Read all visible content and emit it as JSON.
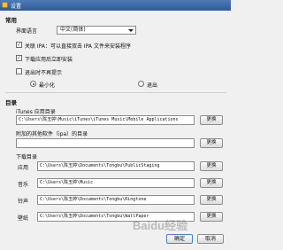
{
  "window": {
    "title": "设置"
  },
  "general": {
    "heading": "常用",
    "language_label": "界面语言",
    "language_value": "中文(简体)",
    "checkboxes": [
      {
        "label": "关联 IPA：可以直接双击 IPA 文件来安装程序",
        "checked": true
      },
      {
        "label": "下载应用后立即安装",
        "checked": true
      },
      {
        "label": "退出时不再提示",
        "checked": false
      }
    ],
    "radios": [
      {
        "label": "最小化",
        "selected": true
      },
      {
        "label": "退出",
        "selected": false
      }
    ]
  },
  "directories": {
    "heading": "目录",
    "itunes_label": "iTunes 应用目录",
    "itunes_path": "C:\\Users\\陈玉婷\\Music\\iTunes\\iTunes Music\\Mobile Applications",
    "attached_label": "附加的其他软件（ipa）的目录",
    "attached_path": "",
    "download_label": "下载目录",
    "downloads": [
      {
        "label": "应用",
        "path": "C:\\Users\\陈玉婷\\Documents\\Tongbu\\PublicStaging"
      },
      {
        "label": "音乐",
        "path": "C:\\Users\\陈玉婷\\Music"
      },
      {
        "label": "铃声",
        "path": "C:\\Users\\陈玉婷\\Documents\\Tongbu\\Ringtone"
      },
      {
        "label": "壁纸",
        "path": "C:\\Users\\陈玉婷\\Documents\\Tongbu\\WallPaper"
      }
    ],
    "change_label": "更换"
  },
  "footer": {
    "ok_label": "确定",
    "cancel_label": "取消"
  },
  "watermark": "Baidu经验"
}
